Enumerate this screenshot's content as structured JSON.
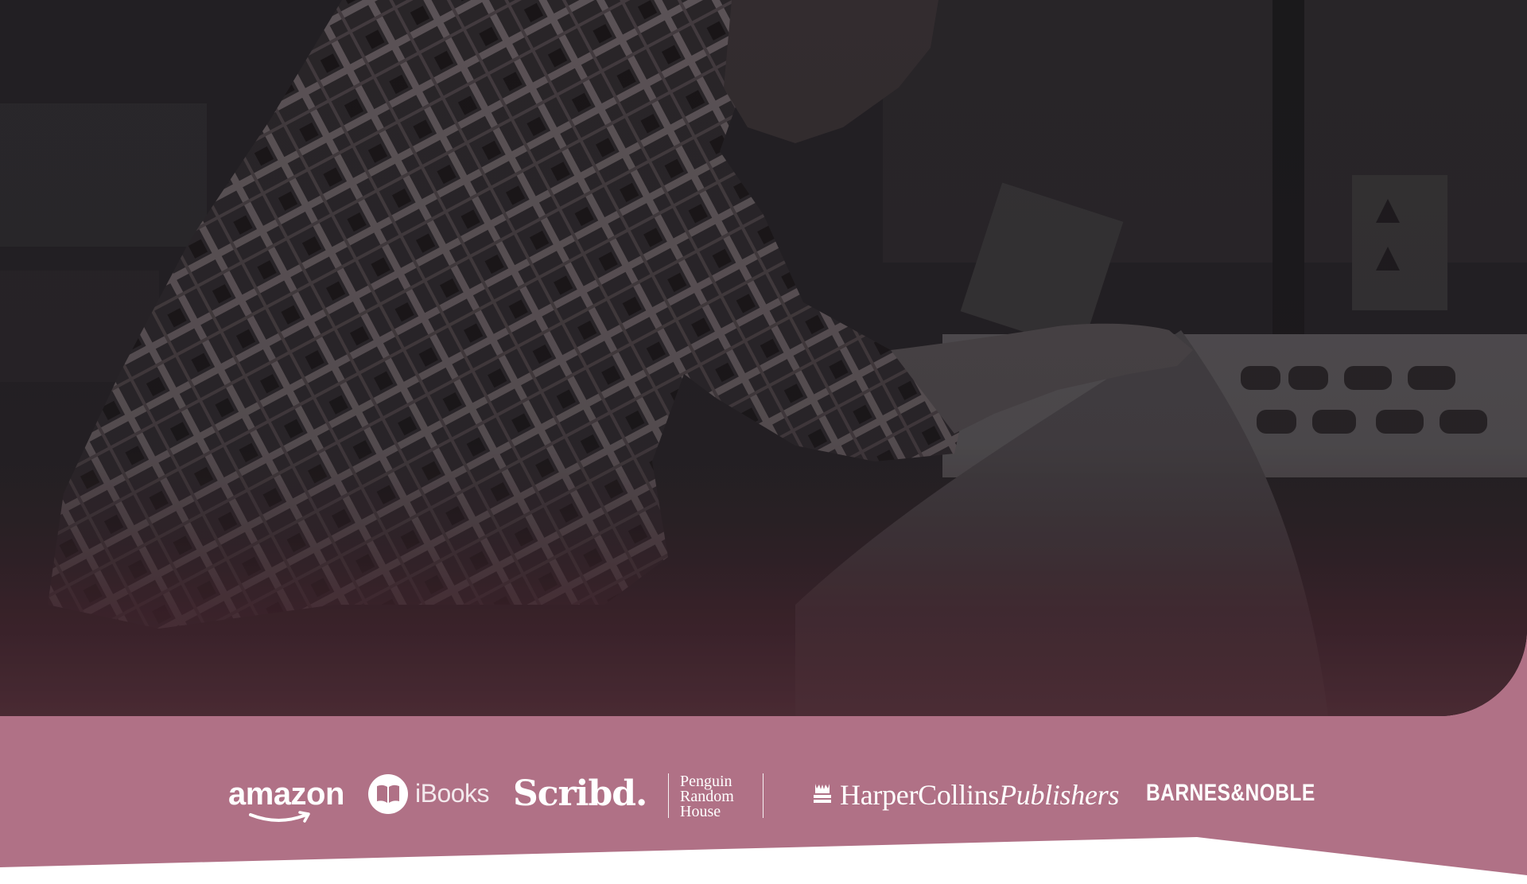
{
  "colors": {
    "band_pink": "#b07186",
    "hero_dark": "#262426",
    "hero_bottom": "#55303a",
    "logo_white": "#ffffff"
  },
  "partners": {
    "amazon": {
      "label": "amazon",
      "icon": "amazon-smile-icon"
    },
    "ibooks": {
      "label": "iBooks",
      "icon": "open-book-icon"
    },
    "scribd": {
      "label": "Scribd."
    },
    "penguin": {
      "line1": "Penguin",
      "line2": "Random",
      "line3": "House"
    },
    "harpercollins": {
      "label_regular": "HarperCollins",
      "label_italic": "Publishers",
      "icon": "fire-water-icon"
    },
    "barnes_noble": {
      "label": "BARNES&NOBLE"
    }
  }
}
